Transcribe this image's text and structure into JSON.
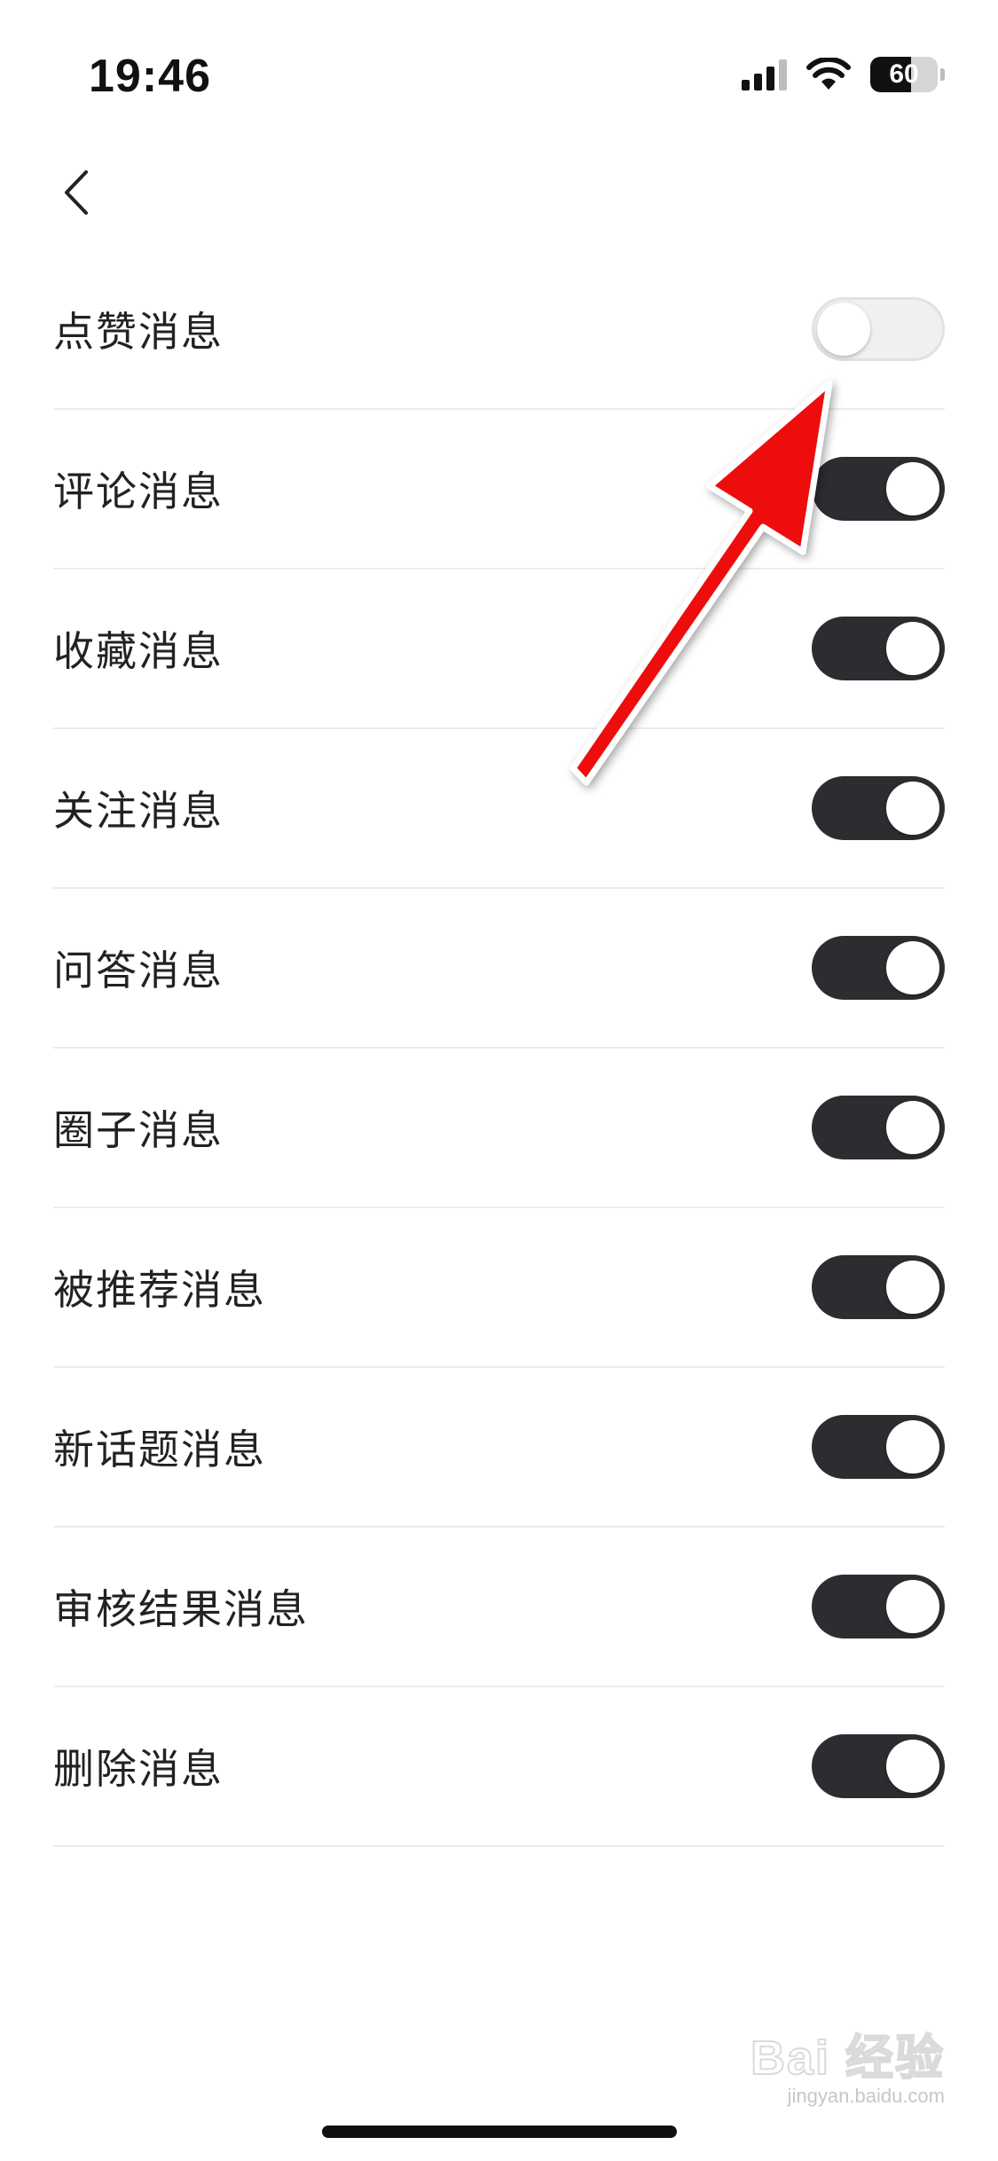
{
  "status_bar": {
    "time": "19:46",
    "battery_level": "60",
    "icons": [
      "signal-icon",
      "wifi-icon",
      "battery-icon"
    ]
  },
  "nav": {
    "back_icon": "chevron-left-icon"
  },
  "settings": [
    {
      "label": "点赞消息",
      "enabled": false
    },
    {
      "label": "评论消息",
      "enabled": true
    },
    {
      "label": "收藏消息",
      "enabled": true
    },
    {
      "label": "关注消息",
      "enabled": true
    },
    {
      "label": "问答消息",
      "enabled": true
    },
    {
      "label": "圈子消息",
      "enabled": true
    },
    {
      "label": "被推荐消息",
      "enabled": true
    },
    {
      "label": "新话题消息",
      "enabled": true
    },
    {
      "label": "审核结果消息",
      "enabled": true
    },
    {
      "label": "删除消息",
      "enabled": true
    }
  ],
  "annotation": {
    "type": "red-arrow",
    "color": "#ee1111",
    "points_to": "settings.0"
  },
  "watermark": {
    "main": "Bai  经验",
    "sub": "jingyan.baidu.com"
  },
  "colors": {
    "toggle_on": "#2b2d31",
    "toggle_off": "#f0f0f0",
    "arrow": "#ee1111"
  }
}
